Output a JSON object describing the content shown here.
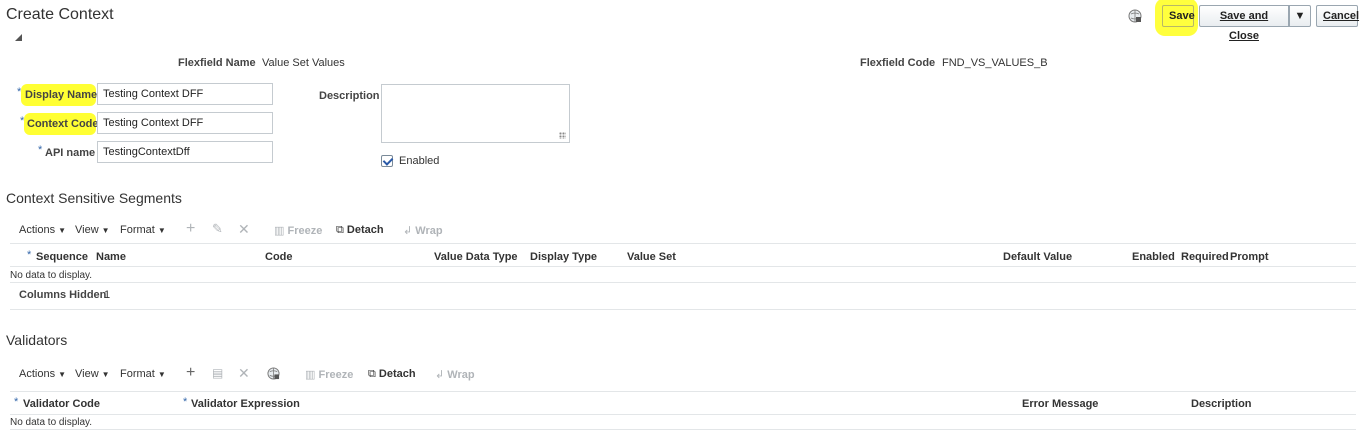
{
  "header": {
    "title": "Create Context",
    "save_label": "Save",
    "save_close_label": "Save and Close",
    "cancel_label": "Cancel",
    "highlight_color": "#ffff33"
  },
  "info": {
    "flexfield_name_label": "Flexfield Name",
    "flexfield_name_value": "Value Set Values",
    "flexfield_code_label": "Flexfield Code",
    "flexfield_code_value": "FND_VS_VALUES_B"
  },
  "form": {
    "required_mark": "*",
    "display_name_label": "Display Name",
    "display_name_value": "Testing Context DFF",
    "context_code_label": "Context Code",
    "context_code_value": "Testing Context DFF",
    "api_name_label": "API name",
    "api_name_value": "TestingContextDff",
    "description_label": "Description",
    "enabled_label": "Enabled",
    "enabled_checked": true
  },
  "segments": {
    "title": "Context Sensitive Segments",
    "toolbar": {
      "actions": "Actions",
      "view": "View",
      "format": "Format",
      "freeze": "Freeze",
      "detach": "Detach",
      "wrap": "Wrap"
    },
    "columns": [
      "Sequence",
      "Name",
      "Code",
      "Value Data Type",
      "Display Type",
      "Value Set",
      "Default Value",
      "Enabled",
      "Required",
      "Prompt"
    ],
    "no_data": "No data to display.",
    "columns_hidden_label": "Columns Hidden",
    "columns_hidden_count": "1"
  },
  "validators": {
    "title": "Validators",
    "toolbar": {
      "actions": "Actions",
      "view": "View",
      "format": "Format",
      "freeze": "Freeze",
      "detach": "Detach",
      "wrap": "Wrap"
    },
    "columns": [
      "Validator Code",
      "Validator Expression",
      "Error Message",
      "Description"
    ],
    "no_data": "No data to display."
  }
}
